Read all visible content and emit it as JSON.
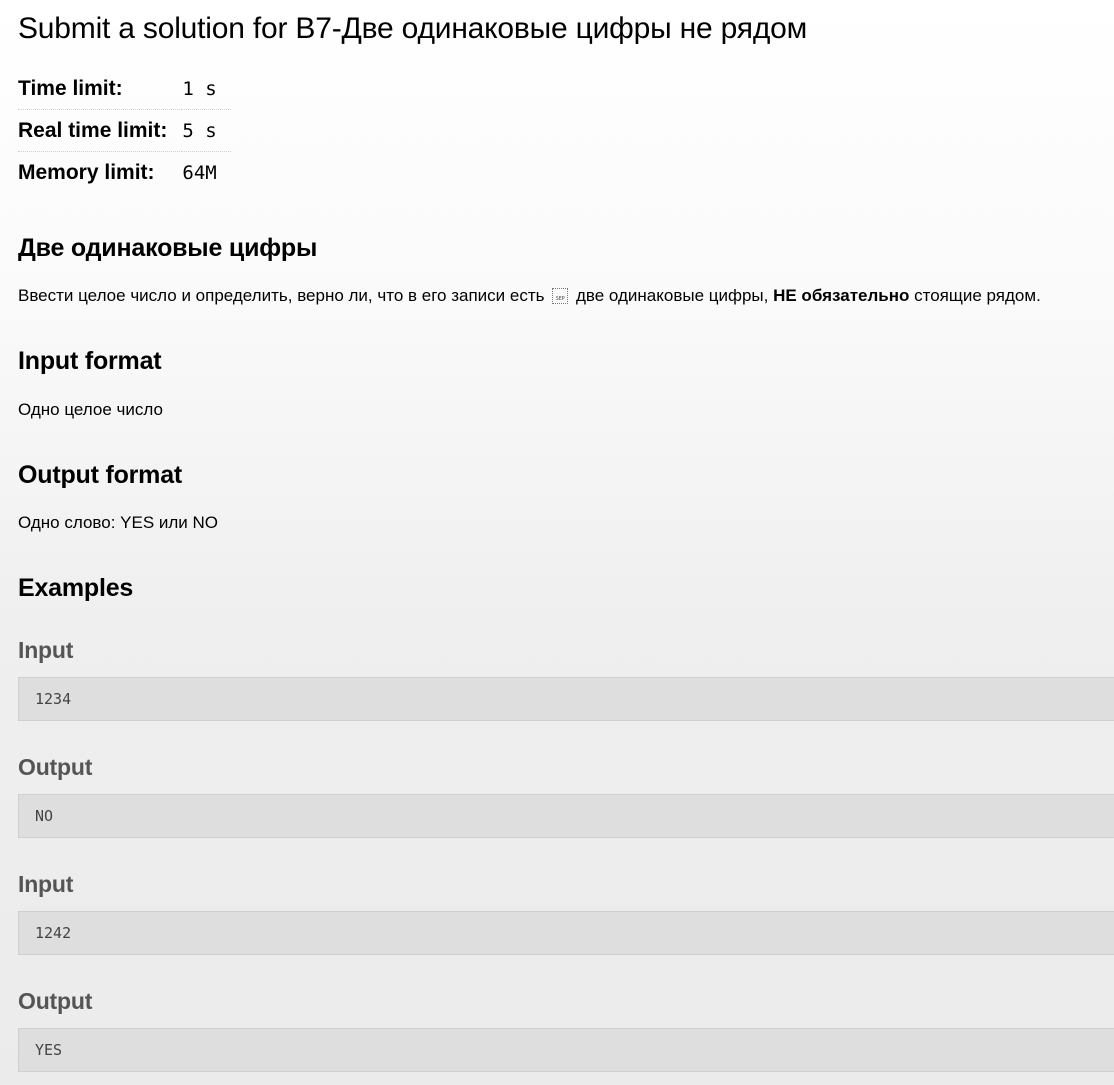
{
  "title": "Submit a solution for B7-Две одинаковые цифры не рядом",
  "limits": [
    {
      "label": "Time limit:",
      "value": "1 s"
    },
    {
      "label": "Real time limit:",
      "value": "5 s"
    },
    {
      "label": "Memory limit:",
      "value": "64M"
    }
  ],
  "statement": {
    "heading": "Две одинаковые цифры",
    "text_before": "Ввести целое число и определить, верно ли, что в его записи есть",
    "text_middle": "две одинаковые цифры,",
    "text_bold": "НЕ обязательно",
    "text_after": "стоящие рядом."
  },
  "input_format": {
    "heading": "Input format",
    "text": "Одно целое число"
  },
  "output_format": {
    "heading": "Output format",
    "text": "Одно слово: YES или NO"
  },
  "examples": {
    "heading": "Examples",
    "items": [
      {
        "label": "Input",
        "value": "1234"
      },
      {
        "label": "Output",
        "value": "NO"
      },
      {
        "label": "Input",
        "value": "1242"
      },
      {
        "label": "Output",
        "value": "YES"
      }
    ]
  }
}
